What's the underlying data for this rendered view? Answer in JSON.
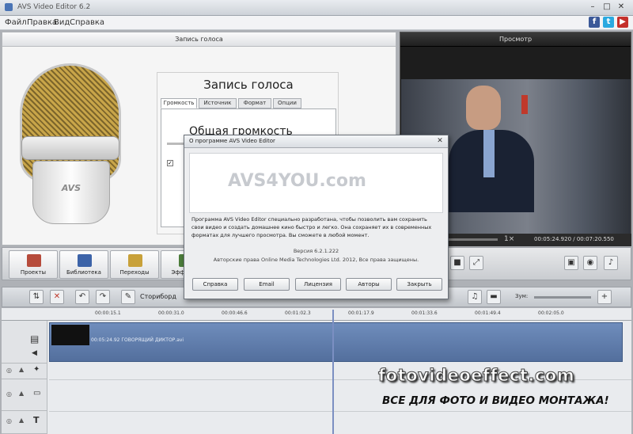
{
  "window": {
    "title": "AVS Video Editor 6.2"
  },
  "menu": [
    "Файл",
    "Правка",
    "Вид",
    "Справка"
  ],
  "social": [
    {
      "name": "facebook-icon",
      "glyph": "f",
      "color": "#3b5998"
    },
    {
      "name": "twitter-icon",
      "glyph": "t",
      "color": "#2aa9e0"
    },
    {
      "name": "youtube-icon",
      "glyph": "▶",
      "color": "#c4302b"
    }
  ],
  "left_panel": {
    "header": "Запись голоса",
    "title": "Запись голоса",
    "tabs": [
      "Громкость",
      "Источник",
      "Формат",
      "Опции"
    ],
    "subtitle": "Общая громкость",
    "mic_logo": "AVS"
  },
  "right_panel": {
    "header": "Просмотр",
    "timecode": "00:05:24.920 / 00:07:20.550"
  },
  "toolbar_buttons": [
    {
      "label": "Проекты",
      "color": "#b64b3b"
    },
    {
      "label": "Библиотека",
      "color": "#3c63a8"
    },
    {
      "label": "Переходы",
      "color": "#c8a13a"
    },
    {
      "label": "Эффекты",
      "color": "#4c7d3b"
    }
  ],
  "timeline": {
    "storyboard_label": "Сториборд",
    "ticks": [
      "00:00:15.1",
      "00:00:31.0",
      "00:00:46.6",
      "00:01:02.3",
      "00:01:17.9",
      "00:01:33.6",
      "00:01:49.4",
      "00:02:05.0"
    ],
    "clip_name": "00:05:24.92 ГОВОРЯЩИЙ ДИКТОР.avi",
    "zoom_label": "Зум:"
  },
  "dialog": {
    "title": "О программе AVS Video Editor",
    "logo": "AVS4YOU.com",
    "text": "Программа AVS Video Editor специально разработана, чтобы позволить вам сохранить свои видео и создать домашнее кино быстро и легко. Она сохраняет их в современных форматах для лучшего просмотра. Вы сможете в любой момент.",
    "version": "Версия 6.2.1.222",
    "copyright": "Авторские права Online Media Technologies Ltd. 2012, Все права защищены.",
    "buttons": [
      "Справка",
      "Email",
      "Лицензия",
      "Авторы",
      "Закрыть"
    ]
  },
  "watermark": {
    "site": "fotovideoeffect.com",
    "tagline": "ВСЕ ДЛЯ ФОТО И ВИДЕО МОНТАЖА!"
  }
}
